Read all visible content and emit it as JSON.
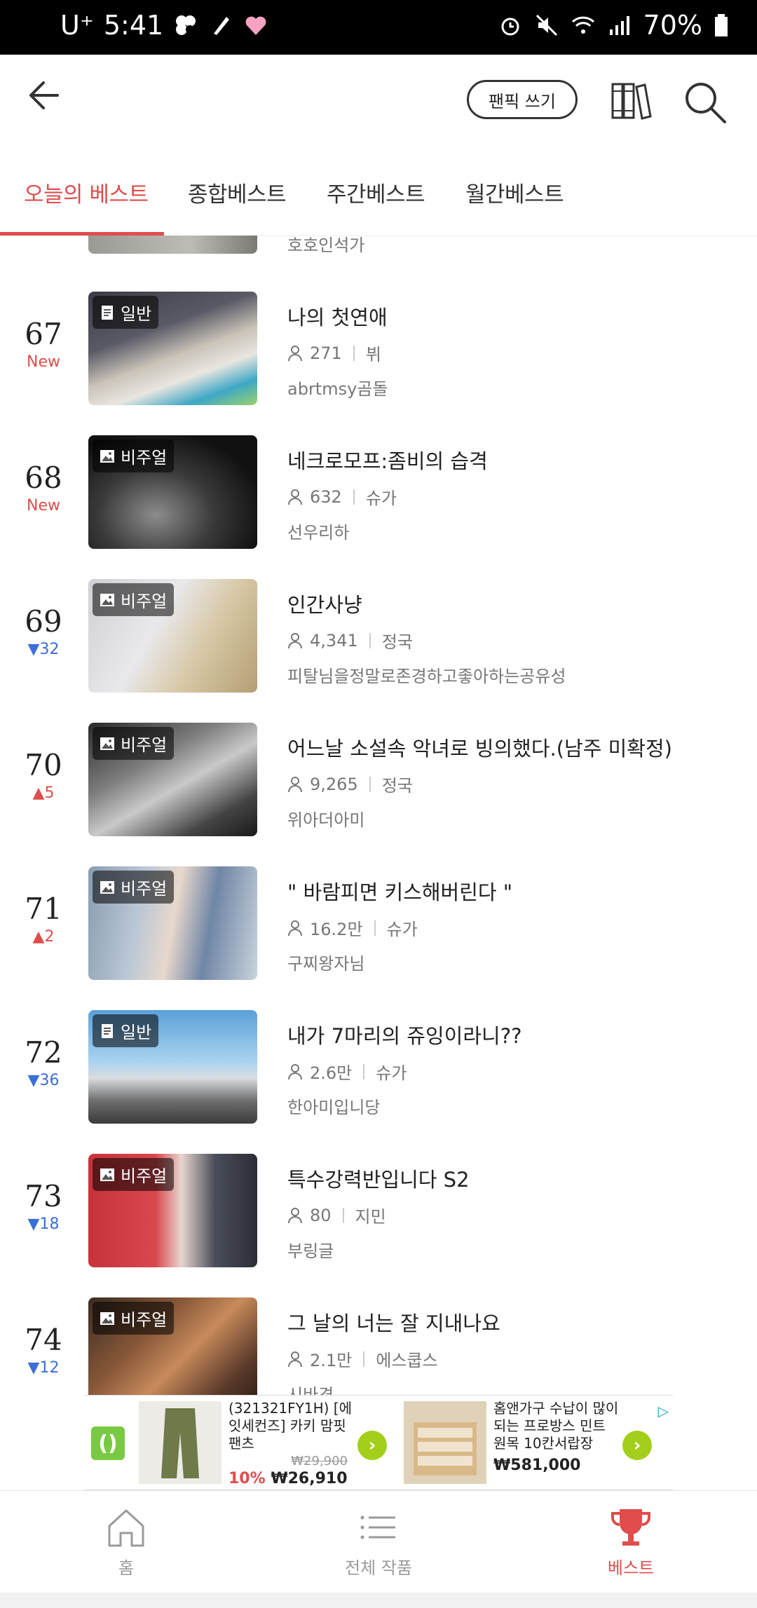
{
  "status_bar": {
    "carrier": "U⁺",
    "time": "5:41",
    "battery": "70%"
  },
  "header": {
    "write_button": "팬픽 쓰기"
  },
  "tabs": [
    "오늘의 베스트",
    "종합베스트",
    "주간베스트",
    "월간베스트"
  ],
  "partial_top_author": "호호인석가",
  "rows": [
    {
      "rank": "67",
      "change": "New",
      "change_type": "new",
      "badge": "일반",
      "badge_type": "text",
      "title": "나의 첫연애",
      "views": "271",
      "tag": "뷔",
      "author": "abrtmsy곰돌"
    },
    {
      "rank": "68",
      "change": "New",
      "change_type": "new",
      "badge": "비주얼",
      "badge_type": "image",
      "title": "네크로모프:좀비의 습격",
      "views": "632",
      "tag": "슈가",
      "author": "선우리하"
    },
    {
      "rank": "69",
      "change": "▼32",
      "change_type": "down",
      "badge": "비주얼",
      "badge_type": "image",
      "title": "인간사냥",
      "views": "4,341",
      "tag": "정국",
      "author": "피탈님을정말로존경하고좋아하는공유성"
    },
    {
      "rank": "70",
      "change": "▲5",
      "change_type": "up",
      "badge": "비주얼",
      "badge_type": "image",
      "title": "어느날 소설속 악녀로 빙의했다.(남주 미확정)",
      "views": "9,265",
      "tag": "정국",
      "author": "위아더아미"
    },
    {
      "rank": "71",
      "change": "▲2",
      "change_type": "up",
      "badge": "비주얼",
      "badge_type": "image",
      "title": "\" 바람피면 키스해버린다 \"",
      "views": "16.2만",
      "tag": "슈가",
      "author": "구찌왕자님"
    },
    {
      "rank": "72",
      "change": "▼36",
      "change_type": "down",
      "badge": "일반",
      "badge_type": "text",
      "title": "내가 7마리의 쥬잉이라니??",
      "views": "2.6만",
      "tag": "슈가",
      "author": "한아미입니당"
    },
    {
      "rank": "73",
      "change": "▼18",
      "change_type": "down",
      "badge": "비주얼",
      "badge_type": "image",
      "title": "특수강력반입니다 S2",
      "views": "80",
      "tag": "지민",
      "author": "부링글"
    },
    {
      "rank": "74",
      "change": "▼12",
      "change_type": "down",
      "badge": "비주얼",
      "badge_type": "image",
      "title": "그 날의 너는 잘 지내나요",
      "views": "2.1만",
      "tag": "에스쿱스",
      "author": "시바견"
    }
  ],
  "ad": {
    "item1": {
      "text": "(321321FY1H) [에잇세컨즈] 카키 맘핏 팬츠",
      "old_price": "₩29,900",
      "discount": "10%",
      "price": "₩26,910"
    },
    "item2": {
      "text": "홈앤가구 수납이 많이 되는 프로방스 민트 원목 10칸서랍장",
      "price": "₩581,000"
    }
  },
  "bottom_nav": {
    "home": "홈",
    "all": "전체 작품",
    "best": "베스트"
  },
  "colors": {
    "accent": "#e14c4c",
    "down": "#3a6fd8"
  }
}
